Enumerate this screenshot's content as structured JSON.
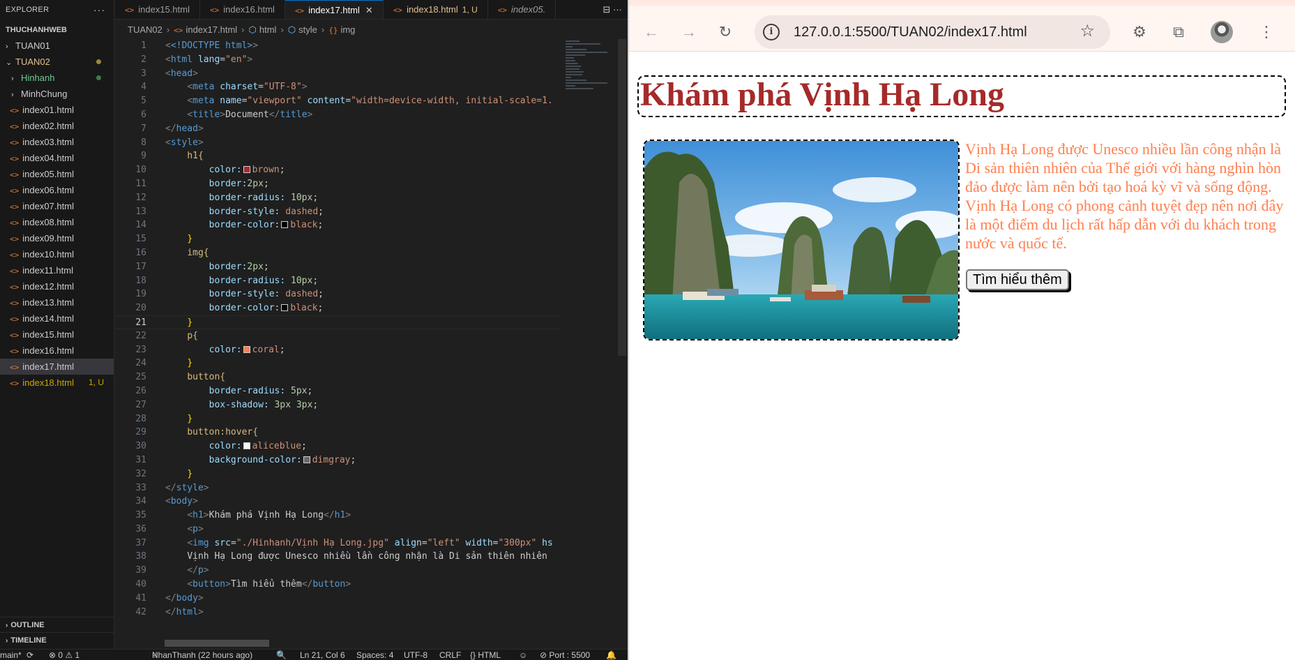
{
  "explorer": {
    "title": "EXPLORER",
    "more": "···",
    "root": "THUCHANHWEB",
    "folders": [
      {
        "label": "TUAN01",
        "chev": "›"
      },
      {
        "label": "TUAN02",
        "chev": "⌄"
      }
    ],
    "subfolders": [
      {
        "label": "Hinhanh",
        "chev": "›"
      },
      {
        "label": "MinhChung",
        "chev": "›"
      }
    ],
    "files": [
      "index01.html",
      "index02.html",
      "index03.html",
      "index04.html",
      "index05.html",
      "index06.html",
      "index07.html",
      "index08.html",
      "index09.html",
      "index10.html",
      "index11.html",
      "index12.html",
      "index13.html",
      "index14.html",
      "index15.html",
      "index16.html",
      "index17.html",
      "index18.html"
    ],
    "file_badge": "1, U",
    "outline": "OUTLINE",
    "timeline": "TIMELINE",
    "colors": {
      "modified": "#e2c08d",
      "untracked": "#73c991",
      "warn": "#cca700"
    }
  },
  "tabs": [
    {
      "label": "index15.html"
    },
    {
      "label": "index16.html"
    },
    {
      "label": "index17.html",
      "close": "✕"
    },
    {
      "label": "index18.html",
      "badge": "1, U"
    },
    {
      "label": "index05."
    }
  ],
  "tab_actions": "⊟ ···",
  "breadcrumb": [
    "TUAN02",
    "index17.html",
    "html",
    "style",
    "img"
  ],
  "code_lines": [
    "1",
    "2",
    "3",
    "4",
    "5",
    "6",
    "7",
    "8",
    "9",
    "10",
    "11",
    "12",
    "13",
    "14",
    "15",
    "16",
    "17",
    "18",
    "19",
    "20",
    "21",
    "22",
    "23",
    "24",
    "25",
    "26",
    "27",
    "28",
    "29",
    "30",
    "31",
    "32",
    "33",
    "34",
    "35",
    "36",
    "37",
    "38",
    "39",
    "40",
    "41",
    "42"
  ],
  "code": {
    "doctype": "<!DOCTYPE html>",
    "html_open": "html",
    "lang_attr": "lang",
    "lang_val": "\"en\"",
    "head": "head",
    "meta": "meta",
    "charset_attr": "charset",
    "charset_val": "\"UTF-8\"",
    "name_attr": "name",
    "name_val": "\"viewport\"",
    "content_attr": "content",
    "content_val": "\"width=device-width, initial-scale=1.",
    "title_tag": "title",
    "title_text": "Document",
    "style": "style",
    "sel_h1": "h1{",
    "sel_img": "img{",
    "sel_p": "p{",
    "sel_button": "button{",
    "sel_button_hover": "button:hover{",
    "close_brace": "}",
    "p_color": "color:",
    "p_border": "border:",
    "p_radius": "border-radius:",
    "p_bstyle": "border-style:",
    "p_bcolor": "border-color:",
    "p_shadow": "box-shadow:",
    "p_bg": "background-color:",
    "v_brown": "brown",
    "v_2px": "2px",
    "v_10px": "10px",
    "v_dashed": "dashed",
    "v_black": "black",
    "v_coral": "coral",
    "v_5px": "5px",
    "v_3px": "3px 3px",
    "v_aliceblue": "aliceblue",
    "v_dimgray": "dimgray",
    "semi": ";",
    "body": "body",
    "h1": "h1",
    "h1_text": "Khám phá Vịnh Hạ Long",
    "p": "p",
    "img": "img",
    "src_attr": "src",
    "src_val": "\"./Hinhanh/Vịnh Hạ Long.jpg\"",
    "align_attr": "align",
    "align_val": "\"left\"",
    "width_attr": "width",
    "width_val": "\"300px\"",
    "hs": "hs",
    "p_text_line": "Vịnh Hạ Long được Unesco nhiều lần công nhận là Di sản thiên nhiên",
    "button": "button",
    "button_text": "Tìm hiểu thêm"
  },
  "status": {
    "branch": "main*",
    "sync": "⟳",
    "problems": "⊗ 0 ⚠ 1",
    "blame": "NhanThanh (22 hours ago)",
    "zoom": "🔍",
    "cursor": "Ln 21, Col 6",
    "spaces": "Spaces: 4",
    "encoding": "UTF-8",
    "eol": "CRLF",
    "language": "{} HTML",
    "port": "⊘ Port : 5500",
    "bell": "🔔"
  },
  "browser": {
    "back": "←",
    "forward": "→",
    "reload": "↻",
    "info": "i",
    "url": "127.0.0.1:5500/TUAN02/index17.html",
    "star": "☆",
    "menu": "⋮",
    "ext1": "⚙",
    "ext2": "⧉"
  },
  "webpage": {
    "heading": "Khám phá Vịnh Hạ Long",
    "paragraph": "Vịnh Hạ Long được Unesco nhiều lần công nhận là Di sản thiên nhiên của Thế giới với hàng nghìn hòn đảo được làm nên bởi tạo hoá kỳ vĩ và sống động. Vịnh Hạ Long có phong cảnh tuyệt đẹp nên nơi đây là một điểm du lịch rất hấp dẫn với du khách trong nước và quốc tế.",
    "button": "Tìm hiểu thêm",
    "colors": {
      "heading": "brown",
      "paragraph": "coral"
    }
  }
}
